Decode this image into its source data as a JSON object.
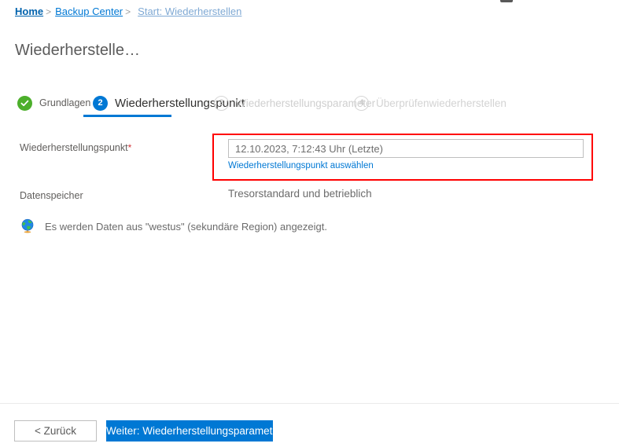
{
  "breadcrumb": {
    "items": [
      {
        "label": "Home",
        "separator": ">"
      },
      {
        "label": "Backup Center",
        "separator": ">"
      },
      {
        "label": "Start: Wiederherstellen",
        "separator": ""
      }
    ]
  },
  "page": {
    "title": "Wiederherstelle…"
  },
  "wizard": {
    "steps": [
      {
        "number": "✓",
        "label": "Grundlagen",
        "state": "done"
      },
      {
        "number": "2",
        "label": "Wiederherstellungspunkt",
        "state": "active"
      },
      {
        "number": "3",
        "label": "Wiederherstellungsparameter",
        "state": "idle"
      },
      {
        "number": "4",
        "label": "Überprüfenwiederherstellen",
        "state": "idle"
      }
    ]
  },
  "form": {
    "recovery_point": {
      "label": "Wiederherstellungspunkt",
      "required_marker": "*",
      "value": "12.10.2023, 7:12:43 Uhr (Letzte)",
      "placeholder": "Wiederherstellungspunkt auswählen",
      "link_label": "Wiederherstellungspunkt auswählen"
    },
    "data_store": {
      "label": "Datenspeicher",
      "value": "Tresorstandard und betrieblich"
    }
  },
  "info": {
    "icon": "globe-icon",
    "text": "Es werden Daten aus \"westus\" (sekundäre Region) angezeigt."
  },
  "footer": {
    "back_label": "< Zurück",
    "next_label": "Weiter: Wiederherstellungsparameter"
  },
  "colors": {
    "accent": "#0078d4",
    "success": "#4caf2b",
    "highlight": "#ff0000",
    "required": "#d13438",
    "muted": "#cfcfcf"
  }
}
